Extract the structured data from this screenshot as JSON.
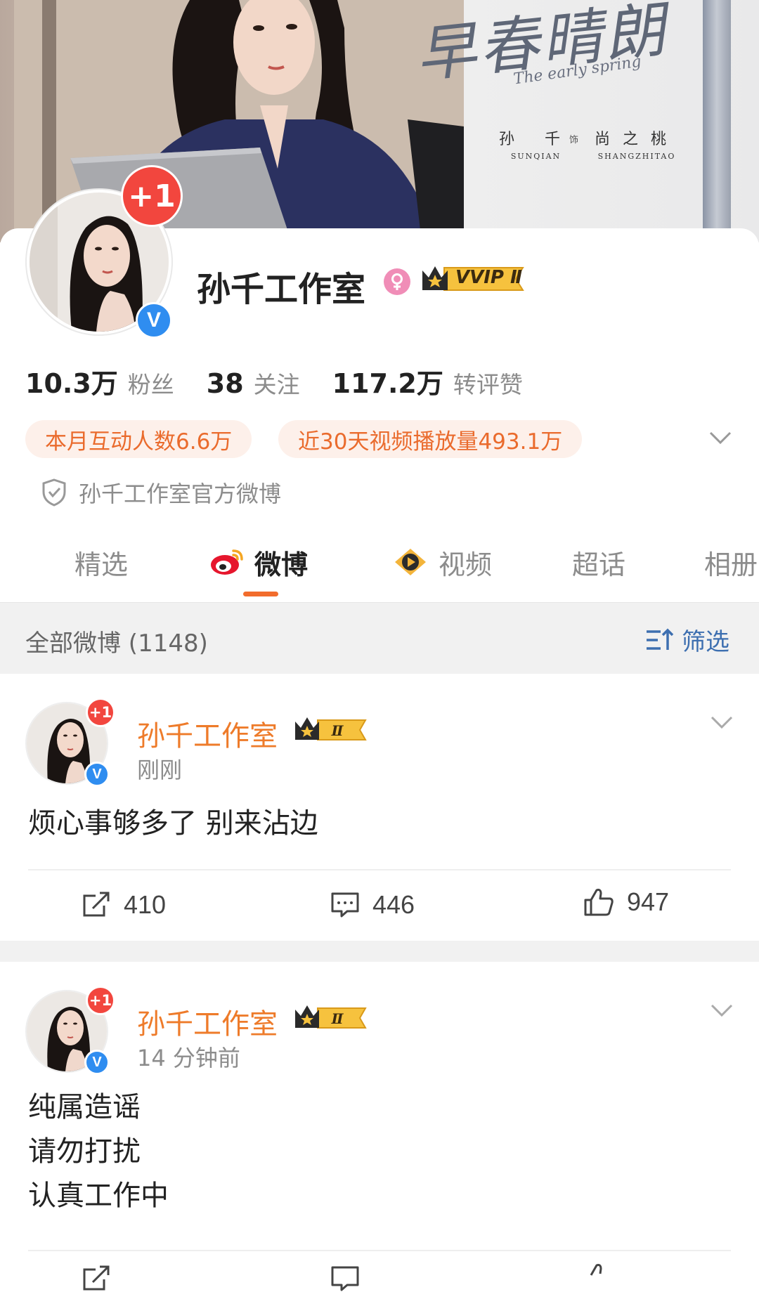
{
  "banner": {
    "title": "早春晴朗",
    "subtitle": "The early spring",
    "cast_left_cn": "孙 千",
    "cast_left_en": "SUNQIAN",
    "cast_role_sep": "饰",
    "cast_right_cn": "尚之桃",
    "cast_right_en": "SHANGZHITAO"
  },
  "profile": {
    "avatar_badge": "+1",
    "verified": "V",
    "name": "孙千工作室",
    "vip_label": "VVIP Ⅱ",
    "stats": [
      {
        "num": "10.3万",
        "label": "粉丝"
      },
      {
        "num": "38",
        "label": "关注"
      },
      {
        "num": "117.2万",
        "label": "转评赞"
      }
    ],
    "pills": [
      "本月互动人数6.6万",
      "近30天视频播放量493.1万"
    ],
    "official": "孙千工作室官方微博"
  },
  "tabs": [
    "精选",
    "微博",
    "视频",
    "超话",
    "相册"
  ],
  "filter": {
    "label": "全部微博 (1148)",
    "button": "筛选"
  },
  "posts": [
    {
      "badge": "+1",
      "name": "孙千工作室",
      "crown_level": "Ⅱ",
      "time": "刚刚",
      "lines": [
        "烦心事够多了 别来沾边"
      ],
      "repost": "410",
      "comment": "446",
      "like": "947"
    },
    {
      "badge": "+1",
      "name": "孙千工作室",
      "crown_level": "Ⅱ",
      "time": "14 分钟前",
      "lines": [
        "纯属造谣",
        "请勿打扰",
        "认真工作中"
      ],
      "repost": "",
      "comment": "",
      "like": ""
    }
  ],
  "colors": {
    "accent": "#f26c2c",
    "name_orange": "#ee7b2a",
    "verified_blue": "#2f8df0",
    "badge_red": "#f2463e"
  }
}
